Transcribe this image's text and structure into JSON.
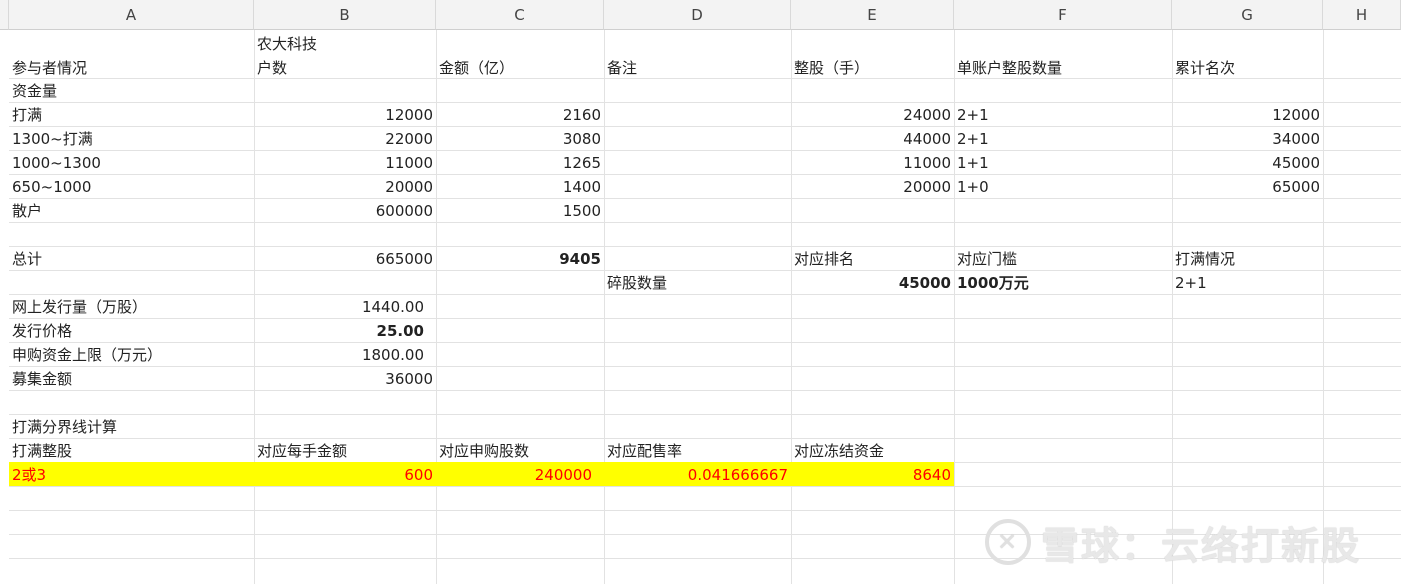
{
  "columns": [
    "A",
    "B",
    "C",
    "D",
    "E",
    "F",
    "G",
    "H"
  ],
  "cells": {
    "b1_line1": "农大科技",
    "a2": "参与者情况",
    "b2": "户数",
    "c2": "金额（亿）",
    "d2": "备注",
    "e2": "整股（手）",
    "f2": "单账户整股数量",
    "g2": "累计名次",
    "a3": "资金量",
    "a4": "打满",
    "b4": "12000",
    "c4": "2160",
    "e4": "24000",
    "f4": "2+1",
    "g4": "12000",
    "a5": "1300~打满",
    "b5": "22000",
    "c5": "3080",
    "e5": "44000",
    "f5": "2+1",
    "g5": "34000",
    "a6": "1000~1300",
    "b6": "11000",
    "c6": "1265",
    "e6": "11000",
    "f6": "1+1",
    "g6": "45000",
    "a7": "650~1000",
    "b7": "20000",
    "c7": "1400",
    "e7": "20000",
    "f7": "1+0",
    "g7": "65000",
    "a8": "散户",
    "b8": "600000",
    "c8": "1500",
    "a10": "总计",
    "b10": "665000",
    "c10": "9405",
    "e10": "对应排名",
    "f10": "对应门槛",
    "g10": "打满情况",
    "d11": "碎股数量",
    "e11": "45000",
    "f11": "1000万元",
    "g11": "2+1",
    "a12": "网上发行量（万股）",
    "b12": "1440.00",
    "a13": "发行价格",
    "b13": "25.00",
    "a14": "申购资金上限（万元）",
    "b14": "1800.00",
    "a15": "募集金额",
    "b15": "36000",
    "a17": "打满分界线计算",
    "a18": "打满整股",
    "b18": "对应每手金额",
    "c18": "对应申购股数",
    "d18": "对应配售率",
    "e18": "对应冻结资金",
    "a19": "2或3",
    "b19": "600",
    "c19": "240000",
    "d19": "0.041666667",
    "e19": "8640"
  },
  "watermark": {
    "icon": "snowball-logo",
    "text": "雪球：云络打新股"
  },
  "colors": {
    "highlight": "#ffff00",
    "highlight_text": "#ff0000"
  }
}
